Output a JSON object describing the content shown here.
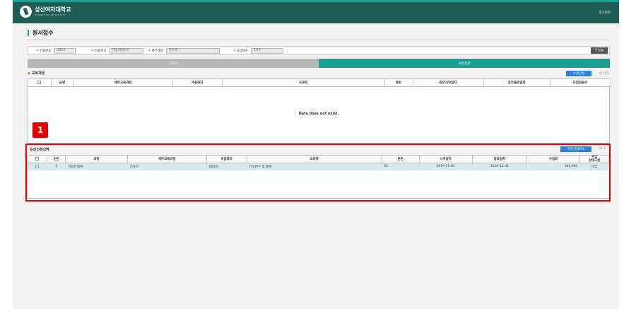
{
  "header": {
    "logo_title": "성신여자대학교",
    "logo_subtitle": "SUNGSHIN UNIVERSITY",
    "logout": "로그아웃"
  },
  "page": {
    "title": "원서접수"
  },
  "search": {
    "year_label": "전형년도",
    "year_value": "2019",
    "term_label": "전형학기",
    "term_value": "겨울계절학기",
    "course_label": "세부과정",
    "course_value": "간호학",
    "round_label": "모집차수",
    "round_value": "1차수",
    "list_button": "목록"
  },
  "tabs": [
    {
      "label": "지원서"
    },
    {
      "label": "수강신청"
    }
  ],
  "courses": {
    "title": "교육과정",
    "button": "수강신청",
    "count": "0건",
    "columns": [
      "",
      "순번",
      "세부교육과정",
      "개설회차",
      "교과목",
      "분반",
      "강의시작일자",
      "강의종료일자",
      "모집정원수"
    ],
    "empty_message": "Data does not exist."
  },
  "enrollment": {
    "title": "수강신청내역",
    "button": "수강신청취소",
    "count": "1",
    "columns": [
      "",
      "순번",
      "과정",
      "세부교육과정",
      "개설회차",
      "교과목",
      "분반",
      "시작일자",
      "종료일자",
      "수업료",
      "수납\n상태구분"
    ],
    "rows": [
      {
        "no": "1",
        "program": "학점은행제",
        "detail": "간호학",
        "round": "00회차",
        "subject": "간호연구 및 통계",
        "section": "01",
        "start": "2019-11-04",
        "end": "2019-12-31",
        "fee": "500,000",
        "status": "미납"
      }
    ]
  },
  "annotation": {
    "badge": "1",
    "color": "#e00000"
  }
}
